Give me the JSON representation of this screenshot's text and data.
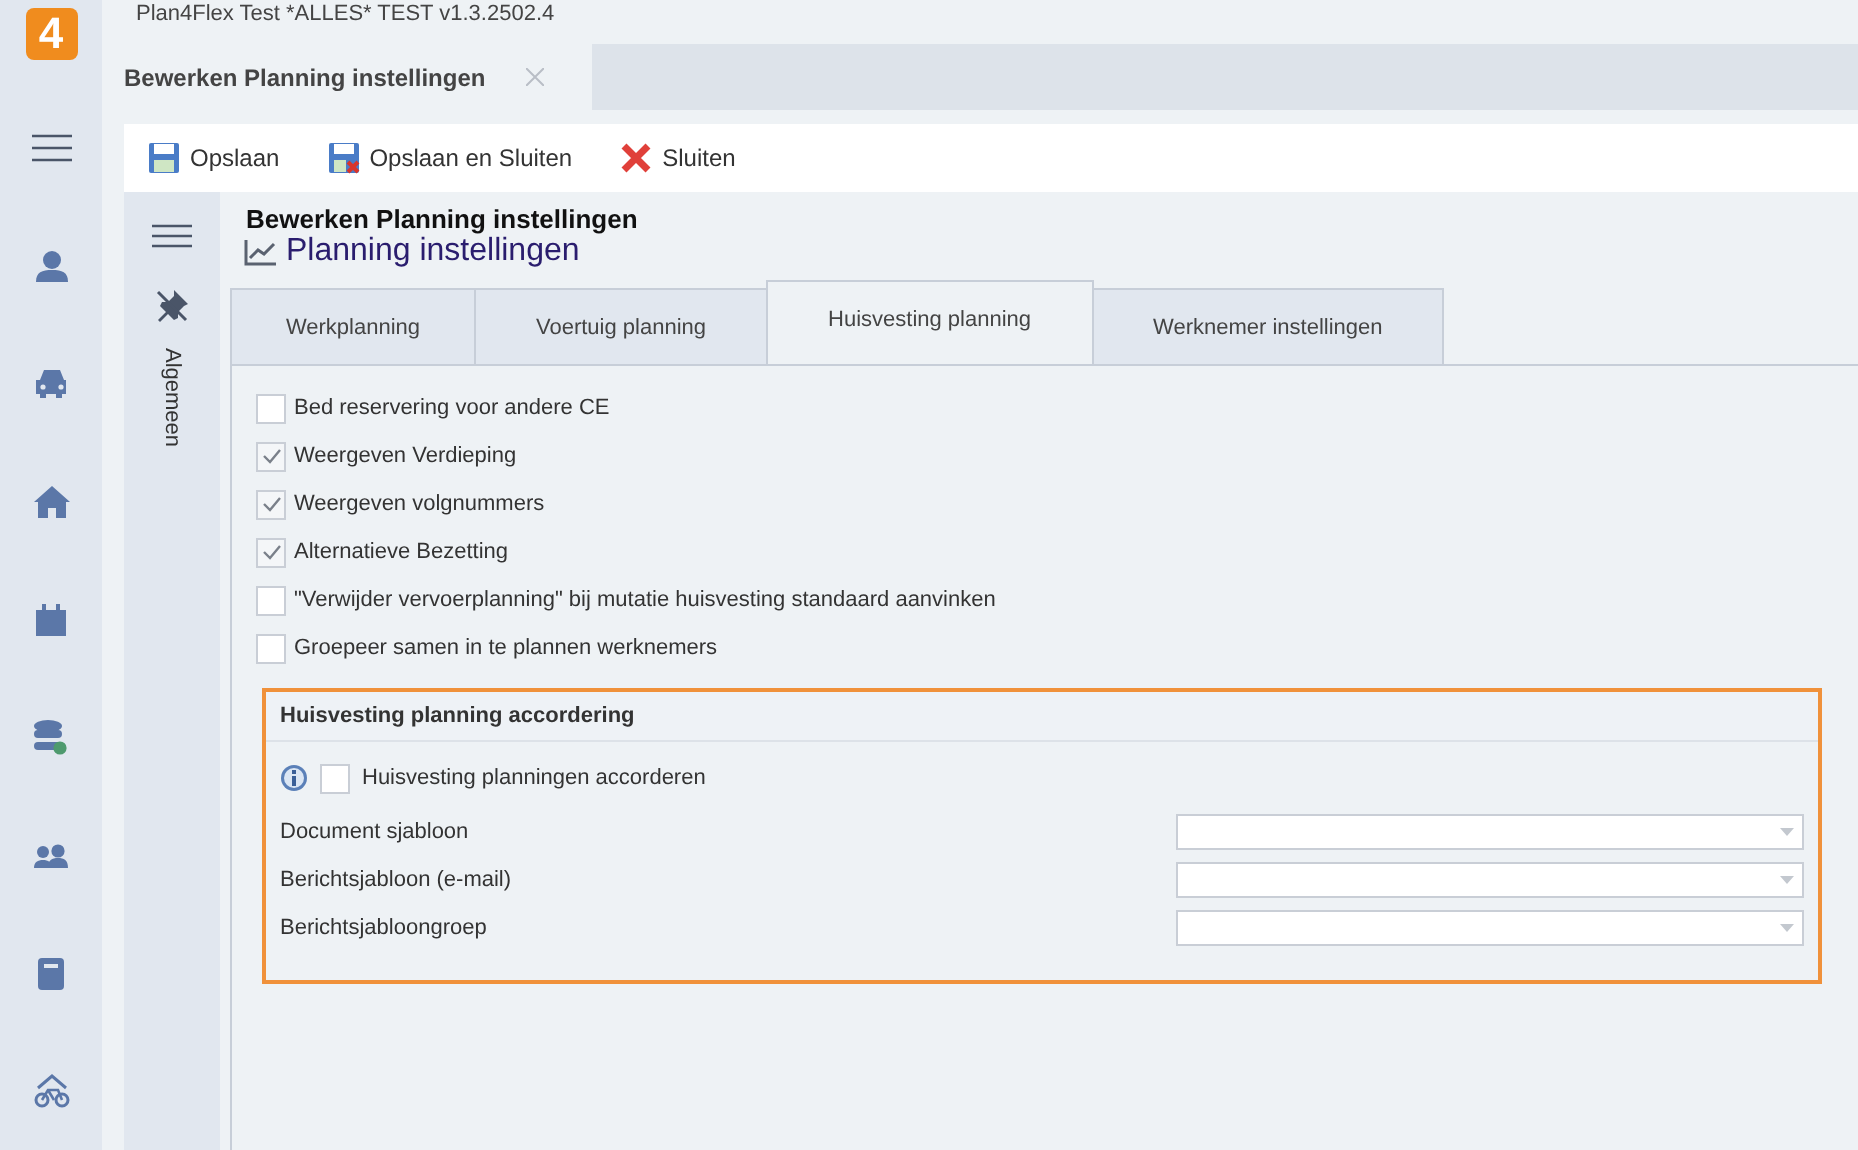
{
  "app": {
    "logo": "4",
    "title": "Plan4Flex Test *ALLES* TEST v1.3.2502.4"
  },
  "document_tabs": [
    {
      "label": "Bewerken Planning instellingen",
      "selected": true
    }
  ],
  "toolbar": [
    {
      "kind": "save",
      "label": "Opslaan"
    },
    {
      "kind": "save-close",
      "label": "Opslaan en Sluiten"
    },
    {
      "kind": "close",
      "label": "Sluiten"
    }
  ],
  "side_panel": {
    "label": "Algemeen"
  },
  "heading": "Bewerken Planning instellingen",
  "subtitle": "Planning instellingen",
  "tabs": [
    {
      "label": "Werkplanning",
      "selected": false
    },
    {
      "label": "Voertuig planning",
      "selected": false
    },
    {
      "label": "Huisvesting planning",
      "selected": true
    },
    {
      "label": "Werknemer instellingen",
      "selected": false
    }
  ],
  "options": [
    {
      "label": "Bed reservering voor andere CE",
      "checked": false
    },
    {
      "label": "Weergeven Verdieping",
      "checked": true
    },
    {
      "label": "Weergeven volgnummers",
      "checked": true
    },
    {
      "label": "Alternatieve Bezetting",
      "checked": true
    },
    {
      "label": "\"Verwijder vervoerplanning\" bij mutatie huisvesting standaard aanvinken",
      "checked": false
    },
    {
      "label": "Groepeer samen in te plannen werknemers",
      "checked": false
    }
  ],
  "group": {
    "title": "Huisvesting planning accordering",
    "highlighted": true,
    "checkbox": {
      "label": "Huisvesting planningen accorderen",
      "checked": false
    },
    "fields": [
      {
        "label": "Document sjabloon"
      },
      {
        "label": "Berichtsjabloon (e-mail)"
      },
      {
        "label": "Berichtsjabloongroep"
      }
    ]
  }
}
